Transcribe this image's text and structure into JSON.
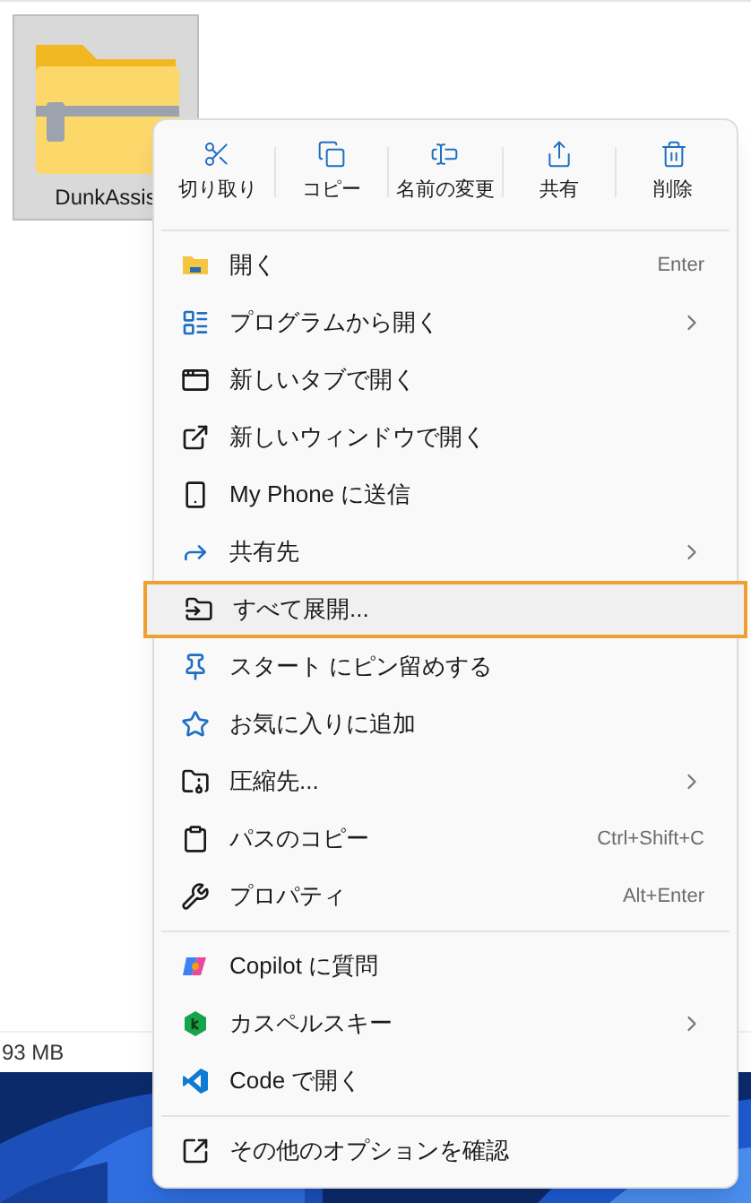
{
  "file_tile": {
    "name": "DunkAssis",
    "selected": true
  },
  "status_bar": {
    "size": "93 MB"
  },
  "context_menu": {
    "toolbar": [
      {
        "label": "切り取り"
      },
      {
        "label": "コピー"
      },
      {
        "label": "名前の変更"
      },
      {
        "label": "共有"
      },
      {
        "label": "削除"
      }
    ],
    "sections": [
      {
        "items": [
          {
            "label": "開く",
            "shortcut": "Enter",
            "submenu": false,
            "highlighted": false
          },
          {
            "label": "プログラムから開く",
            "submenu": true,
            "highlighted": false
          },
          {
            "label": "新しいタブで開く",
            "submenu": false,
            "highlighted": false
          },
          {
            "label": "新しいウィンドウで開く",
            "submenu": false,
            "highlighted": false
          },
          {
            "label": "My Phone に送信",
            "submenu": false,
            "highlighted": false
          },
          {
            "label": "共有先",
            "submenu": true,
            "highlighted": false
          },
          {
            "label": "すべて展開...",
            "submenu": false,
            "highlighted": true
          },
          {
            "label": "スタート にピン留めする",
            "submenu": false,
            "highlighted": false
          },
          {
            "label": "お気に入りに追加",
            "submenu": false,
            "highlighted": false
          },
          {
            "label": "圧縮先...",
            "submenu": true,
            "highlighted": false
          },
          {
            "label": "パスのコピー",
            "shortcut": "Ctrl+Shift+C",
            "submenu": false,
            "highlighted": false
          },
          {
            "label": "プロパティ",
            "shortcut": "Alt+Enter",
            "submenu": false,
            "highlighted": false
          }
        ]
      },
      {
        "items": [
          {
            "label": "Copilot に質問",
            "submenu": false,
            "highlighted": false
          },
          {
            "label": "カスペルスキー",
            "submenu": true,
            "highlighted": false
          },
          {
            "label": "Code で開く",
            "submenu": false,
            "highlighted": false
          }
        ]
      },
      {
        "items": [
          {
            "label": "その他のオプションを確認",
            "submenu": false,
            "highlighted": false
          }
        ]
      }
    ]
  }
}
